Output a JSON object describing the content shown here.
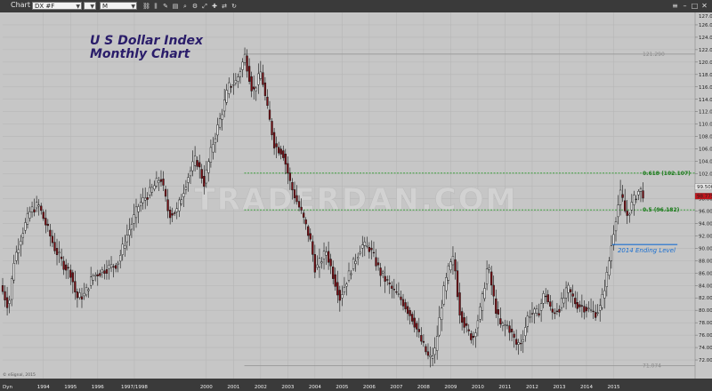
{
  "window": {
    "title": "Chart",
    "symbol": "DX #F",
    "interval": "M"
  },
  "watermark": "TRADERDAN.COM",
  "copyright": "© eSignal, 2015",
  "corner_label": "Dyn",
  "chart_data": {
    "type": "candlestick",
    "title": "U S Dollar Index",
    "subtitle": "Monthly Chart",
    "xlabel": "",
    "ylabel": "",
    "ylim": [
      69,
      128
    ],
    "xlim": [
      1992.5,
      2018.0
    ],
    "grid": true,
    "y_ticks": [
      72.0,
      74.0,
      76.0,
      78.0,
      80.0,
      82.0,
      84.0,
      86.0,
      88.0,
      90.0,
      92.0,
      94.0,
      96.0,
      98.0,
      100.0,
      102.0,
      104.0,
      106.0,
      108.0,
      110.0,
      112.0,
      114.0,
      116.0,
      118.0,
      120.0,
      122.0,
      124.0,
      126.0
    ],
    "y_ticks_top_label": "127.029",
    "x_ticks": [
      {
        "label": "1994",
        "x": 1994.0
      },
      {
        "label": "1995",
        "x": 1995.0
      },
      {
        "label": "1996",
        "x": 1996.0
      },
      {
        "label": "1997/1998",
        "x": 1997.35
      },
      {
        "label": "2000",
        "x": 2000.0
      },
      {
        "label": "2001",
        "x": 2001.0
      },
      {
        "label": "2002",
        "x": 2002.0
      },
      {
        "label": "2003",
        "x": 2003.0
      },
      {
        "label": "2004",
        "x": 2004.0
      },
      {
        "label": "2005",
        "x": 2005.0
      },
      {
        "label": "2006",
        "x": 2006.0
      },
      {
        "label": "2007",
        "x": 2007.0
      },
      {
        "label": "2008",
        "x": 2008.0
      },
      {
        "label": "2009",
        "x": 2009.0
      },
      {
        "label": "2010",
        "x": 2010.0
      },
      {
        "label": "2011",
        "x": 2011.0
      },
      {
        "label": "2012",
        "x": 2012.0
      },
      {
        "label": "2013",
        "x": 2013.0
      },
      {
        "label": "2014",
        "x": 2014.0
      },
      {
        "label": "2015",
        "x": 2015.0
      }
    ],
    "current_price": "98.775",
    "price_labels": [
      "99.500",
      "98.775"
    ],
    "reference_lines": [
      {
        "label": "121.290",
        "value": 121.29,
        "x_start": 2001.4,
        "style": "solid",
        "color": "#909090"
      },
      {
        "label": "0.618 (102.107)",
        "value": 102.107,
        "x_start": 2001.4,
        "style": "dashed",
        "color": "#2a9a2a"
      },
      {
        "label": "0.5 (96.182)",
        "value": 96.182,
        "x_start": 2001.4,
        "style": "dashed",
        "color": "#2a9a2a"
      },
      {
        "label": "71.074",
        "value": 71.074,
        "x_start": 2001.4,
        "style": "solid",
        "color": "#909090"
      }
    ],
    "annotations": [
      {
        "text": "2014 Ending Level",
        "value": 90.6,
        "x_start": 2014.95,
        "x_end": 2017.35,
        "color": "#1a6fd0"
      }
    ],
    "path_anchors": [
      [
        1992.5,
        84.0
      ],
      [
        1992.8,
        80.5
      ],
      [
        1993.0,
        88.0
      ],
      [
        1993.3,
        92.5
      ],
      [
        1993.6,
        96.0
      ],
      [
        1993.9,
        97.0
      ],
      [
        1994.2,
        93.5
      ],
      [
        1994.5,
        90.0
      ],
      [
        1994.8,
        87.5
      ],
      [
        1995.1,
        86.0
      ],
      [
        1995.3,
        82.0
      ],
      [
        1995.6,
        82.5
      ],
      [
        1995.9,
        85.5
      ],
      [
        1996.3,
        86.5
      ],
      [
        1996.8,
        87.5
      ],
      [
        1997.2,
        92.5
      ],
      [
        1997.6,
        97.0
      ],
      [
        1998.0,
        99.0
      ],
      [
        1998.4,
        101.5
      ],
      [
        1998.7,
        95.5
      ],
      [
        1999.0,
        96.0
      ],
      [
        1999.4,
        101.5
      ],
      [
        1999.7,
        104.5
      ],
      [
        2000.0,
        100.5
      ],
      [
        2000.3,
        106.5
      ],
      [
        2000.6,
        111.0
      ],
      [
        2000.9,
        116.0
      ],
      [
        2001.2,
        117.0
      ],
      [
        2001.5,
        121.0
      ],
      [
        2001.8,
        115.0
      ],
      [
        2002.1,
        118.5
      ],
      [
        2002.3,
        113.0
      ],
      [
        2002.6,
        106.5
      ],
      [
        2002.9,
        105.5
      ],
      [
        2003.2,
        100.0
      ],
      [
        2003.6,
        95.5
      ],
      [
        2003.9,
        91.5
      ],
      [
        2004.1,
        86.5
      ],
      [
        2004.5,
        89.5
      ],
      [
        2004.8,
        85.0
      ],
      [
        2005.0,
        82.0
      ],
      [
        2005.4,
        86.5
      ],
      [
        2005.8,
        90.5
      ],
      [
        2006.1,
        90.0
      ],
      [
        2006.5,
        86.0
      ],
      [
        2006.9,
        83.5
      ],
      [
        2007.3,
        81.5
      ],
      [
        2007.7,
        78.5
      ],
      [
        2008.0,
        75.0
      ],
      [
        2008.3,
        72.0
      ],
      [
        2008.5,
        73.5
      ],
      [
        2008.8,
        82.5
      ],
      [
        2009.0,
        86.5
      ],
      [
        2009.2,
        88.5
      ],
      [
        2009.4,
        80.0
      ],
      [
        2009.7,
        76.5
      ],
      [
        2009.9,
        75.5
      ],
      [
        2010.2,
        80.5
      ],
      [
        2010.45,
        87.5
      ],
      [
        2010.7,
        81.0
      ],
      [
        2010.9,
        77.5
      ],
      [
        2011.2,
        77.5
      ],
      [
        2011.5,
        74.5
      ],
      [
        2011.7,
        75.0
      ],
      [
        2011.95,
        79.5
      ],
      [
        2012.3,
        79.5
      ],
      [
        2012.55,
        83.0
      ],
      [
        2012.8,
        79.5
      ],
      [
        2013.1,
        80.5
      ],
      [
        2013.4,
        83.5
      ],
      [
        2013.7,
        81.0
      ],
      [
        2014.0,
        80.5
      ],
      [
        2014.4,
        79.5
      ],
      [
        2014.6,
        80.5
      ],
      [
        2014.85,
        86.0
      ],
      [
        2015.0,
        90.5
      ],
      [
        2015.2,
        96.0
      ],
      [
        2015.35,
        99.0
      ],
      [
        2015.55,
        95.0
      ],
      [
        2015.75,
        97.0
      ],
      [
        2015.9,
        98.5
      ],
      [
        2016.05,
        99.5
      ],
      [
        2016.15,
        98.8
      ]
    ]
  }
}
